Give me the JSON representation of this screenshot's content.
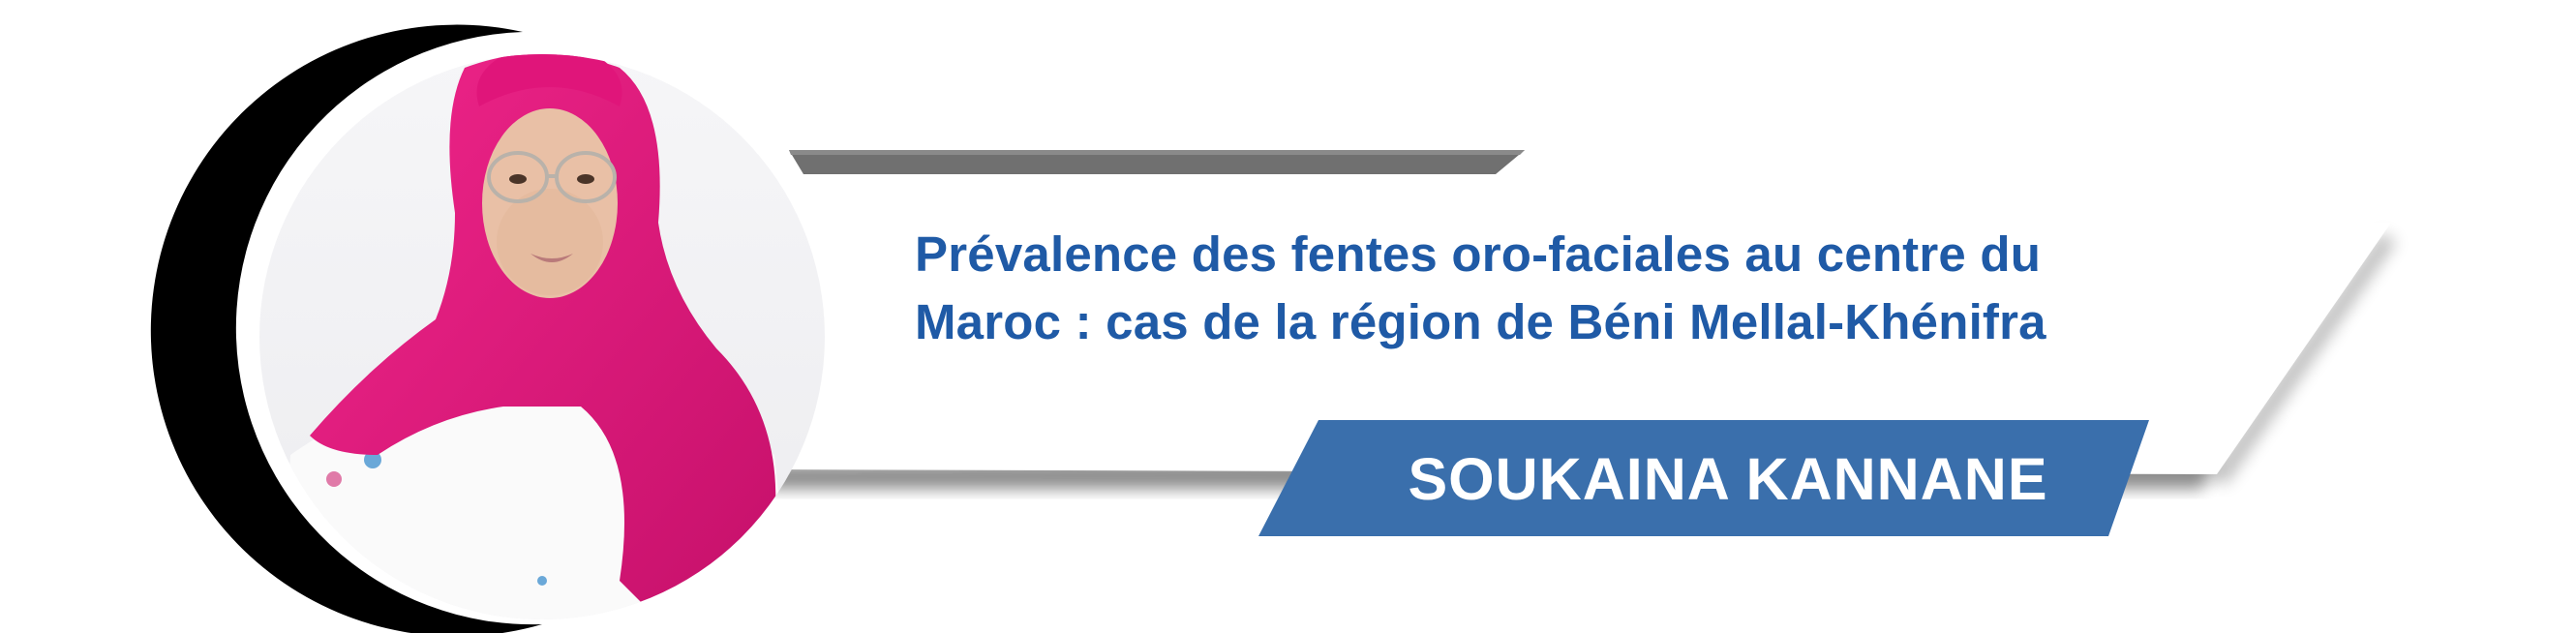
{
  "banner": {
    "title_line_1": "Prévalence des fentes oro-faciales au centre du",
    "title_line_2": "Maroc : cas de la région de Béni Mellal-Khénifra",
    "speaker_name": "SOUKAINA KANNANE"
  },
  "colors": {
    "title_blue": "#1f5aa6",
    "name_bar_blue": "#3a6fac",
    "gray_bar": "#707070",
    "arc_black": "#000000",
    "hijab_pink": "#e4177a"
  },
  "icons": {
    "portrait": "speaker-portrait-photo"
  }
}
